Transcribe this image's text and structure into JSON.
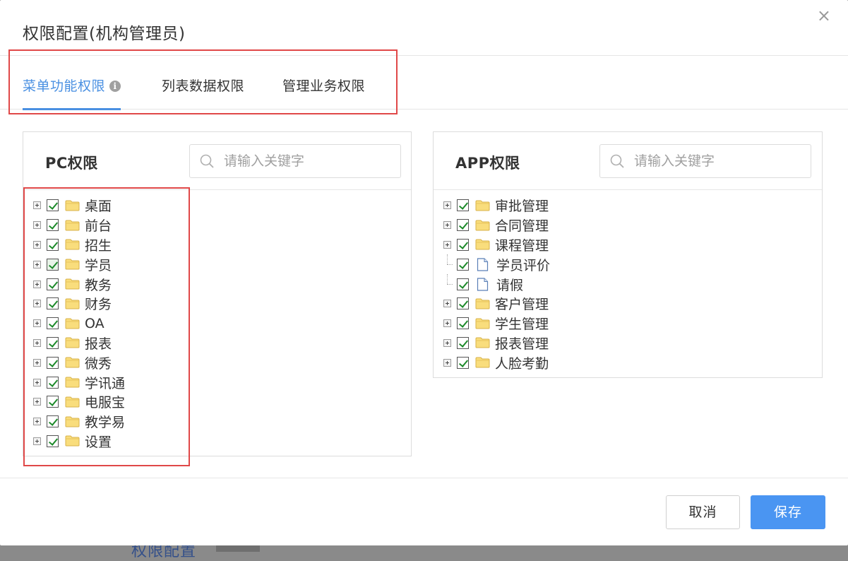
{
  "backdrop": {
    "partial_text": "权限配置"
  },
  "dialog": {
    "title": "权限配置(机构管理员)",
    "close_glyph": "×"
  },
  "tabs": [
    {
      "label": "菜单功能权限",
      "active": true,
      "has_info_icon": true
    },
    {
      "label": "列表数据权限",
      "active": false
    },
    {
      "label": "管理业务权限",
      "active": false
    }
  ],
  "info_glyph": "i",
  "pc_panel": {
    "title": "PC权限",
    "search_placeholder": "请输入关键字",
    "items": [
      {
        "label": "桌面",
        "type": "folder",
        "expandable": true
      },
      {
        "label": "前台",
        "type": "folder",
        "expandable": true
      },
      {
        "label": "招生",
        "type": "folder",
        "expandable": true
      },
      {
        "label": "学员",
        "type": "folder",
        "expandable": true,
        "partial": true
      },
      {
        "label": "教务",
        "type": "folder",
        "expandable": true
      },
      {
        "label": "财务",
        "type": "folder",
        "expandable": true
      },
      {
        "label": "OA",
        "type": "folder",
        "expandable": true
      },
      {
        "label": "报表",
        "type": "folder",
        "expandable": true
      },
      {
        "label": "微秀",
        "type": "folder",
        "expandable": true
      },
      {
        "label": "学讯通",
        "type": "folder",
        "expandable": true
      },
      {
        "label": "电服宝",
        "type": "folder",
        "expandable": true
      },
      {
        "label": "教学易",
        "type": "folder",
        "expandable": true
      },
      {
        "label": "设置",
        "type": "folder",
        "expandable": true
      }
    ]
  },
  "app_panel": {
    "title": "APP权限",
    "search_placeholder": "请输入关键字",
    "items": [
      {
        "label": "审批管理",
        "type": "folder",
        "expandable": true
      },
      {
        "label": "合同管理",
        "type": "folder",
        "expandable": true
      },
      {
        "label": "课程管理",
        "type": "folder",
        "expandable": true
      },
      {
        "label": "学员评价",
        "type": "doc",
        "expandable": false
      },
      {
        "label": "请假",
        "type": "doc",
        "expandable": false
      },
      {
        "label": "客户管理",
        "type": "folder",
        "expandable": true
      },
      {
        "label": "学生管理",
        "type": "folder",
        "expandable": true
      },
      {
        "label": "报表管理",
        "type": "folder",
        "expandable": true
      },
      {
        "label": "人脸考勤",
        "type": "folder",
        "expandable": true
      }
    ]
  },
  "footer": {
    "cancel_label": "取消",
    "save_label": "保存"
  },
  "colors": {
    "accent": "#4a90e2",
    "highlight_border": "#e04848",
    "check_green": "#1d8a2a",
    "folder_yellow": "#f7d774"
  }
}
